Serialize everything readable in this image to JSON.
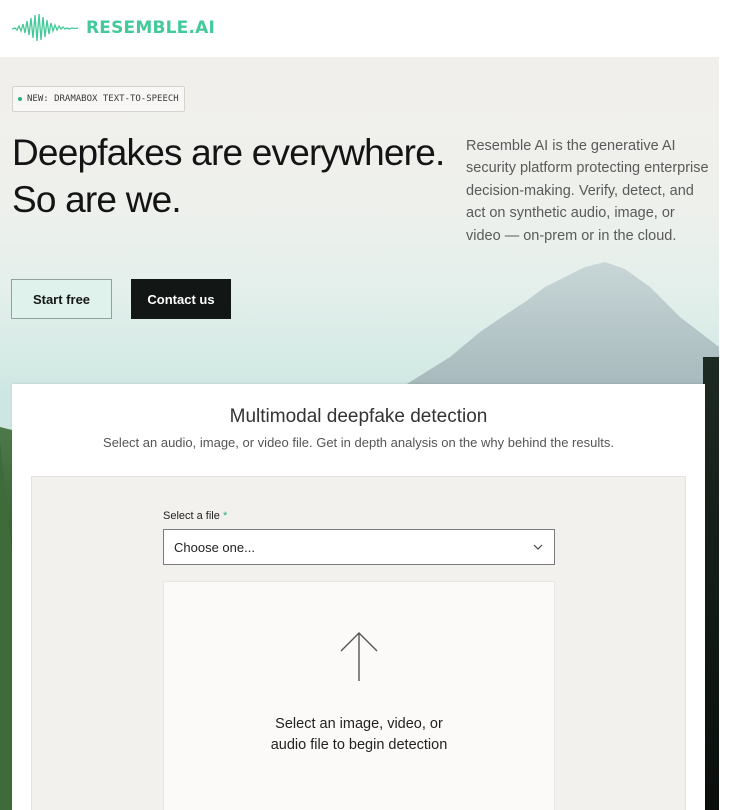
{
  "header": {
    "brand": "RESEMBLE.AI",
    "brand_color": "#44c99a"
  },
  "hero": {
    "badge": "NEW: DRAMABOX TEXT-TO-SPEECH",
    "headline_line1": "Deepfakes are everywhere.",
    "headline_line2": "So are we.",
    "description": "Resemble AI is the generative AI security platform protecting enterprise decision-making. Verify, detect, and act on synthetic audio, image, or video — on-prem or in the cloud.",
    "start_label": "Start free",
    "contact_label": "Contact us"
  },
  "detector": {
    "title": "Multimodal deepfake detection",
    "subtitle": "Select an audio, image, or video file. Get in depth analysis on the why behind the results.",
    "field_label": "Select a file",
    "required_mark": "*",
    "select_value": "Choose one...",
    "drop_line1": "Select an image, video, or",
    "drop_line2": "audio file to begin detection"
  },
  "icons": {
    "logo": "waveform-logo-icon",
    "chevron": "chevron-down-icon",
    "upload": "arrow-up-icon"
  }
}
